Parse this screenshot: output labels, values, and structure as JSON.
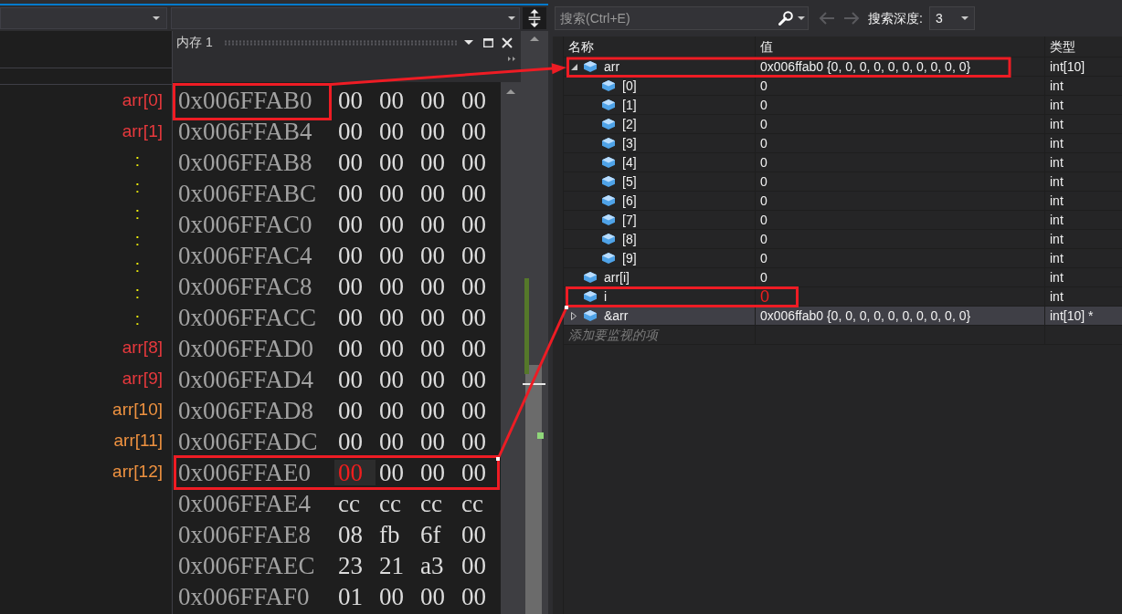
{
  "annotation_labels": [
    {
      "text": "arr[0]",
      "kind": "name",
      "color": "#e8393d"
    },
    {
      "text": "arr[1]",
      "kind": "name",
      "color": "#e8393d"
    },
    {
      "text": ":",
      "kind": "ellipsis",
      "color": "#f0f00a"
    },
    {
      "text": ":",
      "kind": "ellipsis",
      "color": "#f0f00a"
    },
    {
      "text": ":",
      "kind": "ellipsis",
      "color": "#f0f00a"
    },
    {
      "text": ":",
      "kind": "ellipsis",
      "color": "#f0f00a"
    },
    {
      "text": ":",
      "kind": "ellipsis",
      "color": "#f0f00a"
    },
    {
      "text": ":",
      "kind": "ellipsis",
      "color": "#f0f00a"
    },
    {
      "text": ":",
      "kind": "ellipsis",
      "color": "#f0f00a"
    },
    {
      "text": "arr[8]",
      "kind": "name",
      "color": "#e8393d"
    },
    {
      "text": "arr[9]",
      "kind": "name",
      "color": "#e8393d"
    },
    {
      "text": "arr[10]",
      "kind": "name",
      "color": "#ef9240"
    },
    {
      "text": "arr[11]",
      "kind": "name",
      "color": "#ef9240"
    },
    {
      "text": "arr[12]",
      "kind": "name",
      "color": "#ef9240"
    }
  ],
  "memory_window": {
    "title": "内存 1",
    "rows": [
      {
        "address": "0x006FFAB0",
        "bytes": [
          {
            "value": "00",
            "changed": false
          },
          {
            "value": "00",
            "changed": false
          },
          {
            "value": "00",
            "changed": false
          },
          {
            "value": "00",
            "changed": false
          }
        ]
      },
      {
        "address": "0x006FFAB4",
        "bytes": [
          {
            "value": "00",
            "changed": false
          },
          {
            "value": "00",
            "changed": false
          },
          {
            "value": "00",
            "changed": false
          },
          {
            "value": "00",
            "changed": false
          }
        ]
      },
      {
        "address": "0x006FFAB8",
        "bytes": [
          {
            "value": "00",
            "changed": false
          },
          {
            "value": "00",
            "changed": false
          },
          {
            "value": "00",
            "changed": false
          },
          {
            "value": "00",
            "changed": false
          }
        ]
      },
      {
        "address": "0x006FFABC",
        "bytes": [
          {
            "value": "00",
            "changed": false
          },
          {
            "value": "00",
            "changed": false
          },
          {
            "value": "00",
            "changed": false
          },
          {
            "value": "00",
            "changed": false
          }
        ]
      },
      {
        "address": "0x006FFAC0",
        "bytes": [
          {
            "value": "00",
            "changed": false
          },
          {
            "value": "00",
            "changed": false
          },
          {
            "value": "00",
            "changed": false
          },
          {
            "value": "00",
            "changed": false
          }
        ]
      },
      {
        "address": "0x006FFAC4",
        "bytes": [
          {
            "value": "00",
            "changed": false
          },
          {
            "value": "00",
            "changed": false
          },
          {
            "value": "00",
            "changed": false
          },
          {
            "value": "00",
            "changed": false
          }
        ]
      },
      {
        "address": "0x006FFAC8",
        "bytes": [
          {
            "value": "00",
            "changed": false
          },
          {
            "value": "00",
            "changed": false
          },
          {
            "value": "00",
            "changed": false
          },
          {
            "value": "00",
            "changed": false
          }
        ]
      },
      {
        "address": "0x006FFACC",
        "bytes": [
          {
            "value": "00",
            "changed": false
          },
          {
            "value": "00",
            "changed": false
          },
          {
            "value": "00",
            "changed": false
          },
          {
            "value": "00",
            "changed": false
          }
        ]
      },
      {
        "address": "0x006FFAD0",
        "bytes": [
          {
            "value": "00",
            "changed": false
          },
          {
            "value": "00",
            "changed": false
          },
          {
            "value": "00",
            "changed": false
          },
          {
            "value": "00",
            "changed": false
          }
        ]
      },
      {
        "address": "0x006FFAD4",
        "bytes": [
          {
            "value": "00",
            "changed": false
          },
          {
            "value": "00",
            "changed": false
          },
          {
            "value": "00",
            "changed": false
          },
          {
            "value": "00",
            "changed": false
          }
        ]
      },
      {
        "address": "0x006FFAD8",
        "bytes": [
          {
            "value": "00",
            "changed": false
          },
          {
            "value": "00",
            "changed": false
          },
          {
            "value": "00",
            "changed": false
          },
          {
            "value": "00",
            "changed": false
          }
        ]
      },
      {
        "address": "0x006FFADC",
        "bytes": [
          {
            "value": "00",
            "changed": false
          },
          {
            "value": "00",
            "changed": false
          },
          {
            "value": "00",
            "changed": false
          },
          {
            "value": "00",
            "changed": false
          }
        ]
      },
      {
        "address": "0x006FFAE0",
        "bytes": [
          {
            "value": "00",
            "changed": true
          },
          {
            "value": "00",
            "changed": false
          },
          {
            "value": "00",
            "changed": false
          },
          {
            "value": "00",
            "changed": false
          }
        ]
      },
      {
        "address": "0x006FFAE4",
        "bytes": [
          {
            "value": "cc",
            "changed": false
          },
          {
            "value": "cc",
            "changed": false
          },
          {
            "value": "cc",
            "changed": false
          },
          {
            "value": "cc",
            "changed": false
          }
        ]
      },
      {
        "address": "0x006FFAE8",
        "bytes": [
          {
            "value": "08",
            "changed": false
          },
          {
            "value": "fb",
            "changed": false
          },
          {
            "value": "6f",
            "changed": false
          },
          {
            "value": "00",
            "changed": false
          }
        ]
      },
      {
        "address": "0x006FFAEC",
        "bytes": [
          {
            "value": "23",
            "changed": false
          },
          {
            "value": "21",
            "changed": false
          },
          {
            "value": "a3",
            "changed": false
          },
          {
            "value": "00",
            "changed": false
          }
        ]
      },
      {
        "address": "0x006FFAF0",
        "bytes": [
          {
            "value": "01",
            "changed": false
          },
          {
            "value": "00",
            "changed": false
          },
          {
            "value": "00",
            "changed": false
          },
          {
            "value": "00",
            "changed": false
          }
        ]
      }
    ]
  },
  "watch_window": {
    "search": {
      "placeholder": "搜索(Ctrl+E)"
    },
    "nav_buttons": [
      {
        "kind": "back",
        "disabled": true
      },
      {
        "kind": "forward",
        "disabled": true
      }
    ],
    "depth": {
      "label": "搜索深度:",
      "value": "3"
    },
    "columns": [
      "名称",
      "值",
      "类型"
    ],
    "rows": [
      {
        "kind": "group",
        "expanded": true,
        "name": "arr",
        "value": "0x006ffab0 {0, 0, 0, 0, 0, 0, 0, 0, 0, 0}",
        "type": "int[10]",
        "selected": false,
        "changed": false,
        "children": [
          {
            "name": "[0]",
            "value": "0",
            "type": "int",
            "selected": false,
            "changed": false
          },
          {
            "name": "[1]",
            "value": "0",
            "type": "int",
            "selected": false,
            "changed": false
          },
          {
            "name": "[2]",
            "value": "0",
            "type": "int",
            "selected": false,
            "changed": false
          },
          {
            "name": "[3]",
            "value": "0",
            "type": "int",
            "selected": false,
            "changed": false
          },
          {
            "name": "[4]",
            "value": "0",
            "type": "int",
            "selected": false,
            "changed": false
          },
          {
            "name": "[5]",
            "value": "0",
            "type": "int",
            "selected": false,
            "changed": false
          },
          {
            "name": "[6]",
            "value": "0",
            "type": "int",
            "selected": false,
            "changed": false
          },
          {
            "name": "[7]",
            "value": "0",
            "type": "int",
            "selected": false,
            "changed": false
          },
          {
            "name": "[8]",
            "value": "0",
            "type": "int",
            "selected": false,
            "changed": false
          },
          {
            "name": "[9]",
            "value": "0",
            "type": "int",
            "selected": false,
            "changed": false
          }
        ]
      },
      {
        "kind": "leaf",
        "name": "arr[i]",
        "value": "0",
        "type": "int",
        "selected": false,
        "changed": false
      },
      {
        "kind": "leaf",
        "name": "i",
        "value": "0",
        "type": "int",
        "selected": false,
        "changed": true
      },
      {
        "kind": "group",
        "expanded": false,
        "name": "&arr",
        "value": "0x006ffab0 {0, 0, 0, 0, 0, 0, 0, 0, 0, 0}",
        "type": "int[10] *",
        "selected": true,
        "changed": false
      }
    ],
    "add_row": {
      "placeholder": "添加要监视的项"
    }
  }
}
